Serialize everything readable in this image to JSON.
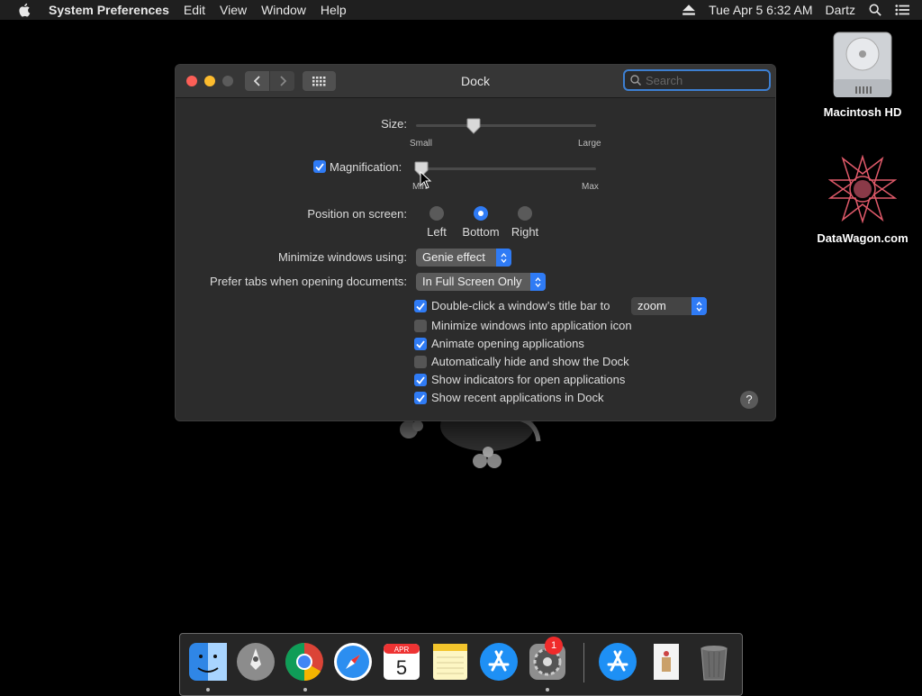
{
  "menubar": {
    "app_name": "System Preferences",
    "menus": [
      "Edit",
      "View",
      "Window",
      "Help"
    ],
    "datetime": "Tue Apr 5  6:32 AM",
    "user": "Dartz"
  },
  "desktop": {
    "icons": [
      {
        "label": "Macintosh HD",
        "icon": "hard-drive-icon"
      },
      {
        "label": "DataWagon.com",
        "icon": "geometric-star-icon"
      }
    ]
  },
  "window": {
    "title": "Dock",
    "search_placeholder": "Search",
    "size": {
      "label": "Size:",
      "min_label": "Small",
      "max_label": "Large",
      "value": 0.32
    },
    "magnification": {
      "label": "Magnification:",
      "checked": true,
      "min_label": "Min",
      "max_label": "Max",
      "value": 0.03
    },
    "position": {
      "label": "Position on screen:",
      "options": [
        "Left",
        "Bottom",
        "Right"
      ],
      "selected": "Bottom"
    },
    "minimize": {
      "label": "Minimize windows using:",
      "value": "Genie effect"
    },
    "prefer_tabs": {
      "label": "Prefer tabs when opening documents:",
      "value": "In Full Screen Only"
    },
    "double_click": {
      "label": "Double-click a window’s title bar to",
      "checked": true,
      "value": "zoom"
    },
    "options": [
      {
        "label": "Minimize windows into application icon",
        "checked": false
      },
      {
        "label": "Animate opening applications",
        "checked": true
      },
      {
        "label": "Automatically hide and show the Dock",
        "checked": false
      },
      {
        "label": "Show indicators for open applications",
        "checked": true
      },
      {
        "label": "Show recent applications in Dock",
        "checked": true
      }
    ],
    "help_label": "?"
  },
  "dock": {
    "items": [
      "finder-icon",
      "launchpad-icon",
      "chrome-icon",
      "safari-icon",
      "calendar-icon",
      "notes-icon",
      "app-store-icon",
      "system-preferences-icon",
      "app-store-download-icon",
      "document-icon",
      "trash-icon"
    ],
    "calendar_month": "APR",
    "calendar_day": "5",
    "badge_count": "1"
  },
  "colors": {
    "accent": "#2f7bf5",
    "window_bg": "#2c2c2c",
    "close": "#fc5f57",
    "minimize": "#fdbc2e"
  }
}
